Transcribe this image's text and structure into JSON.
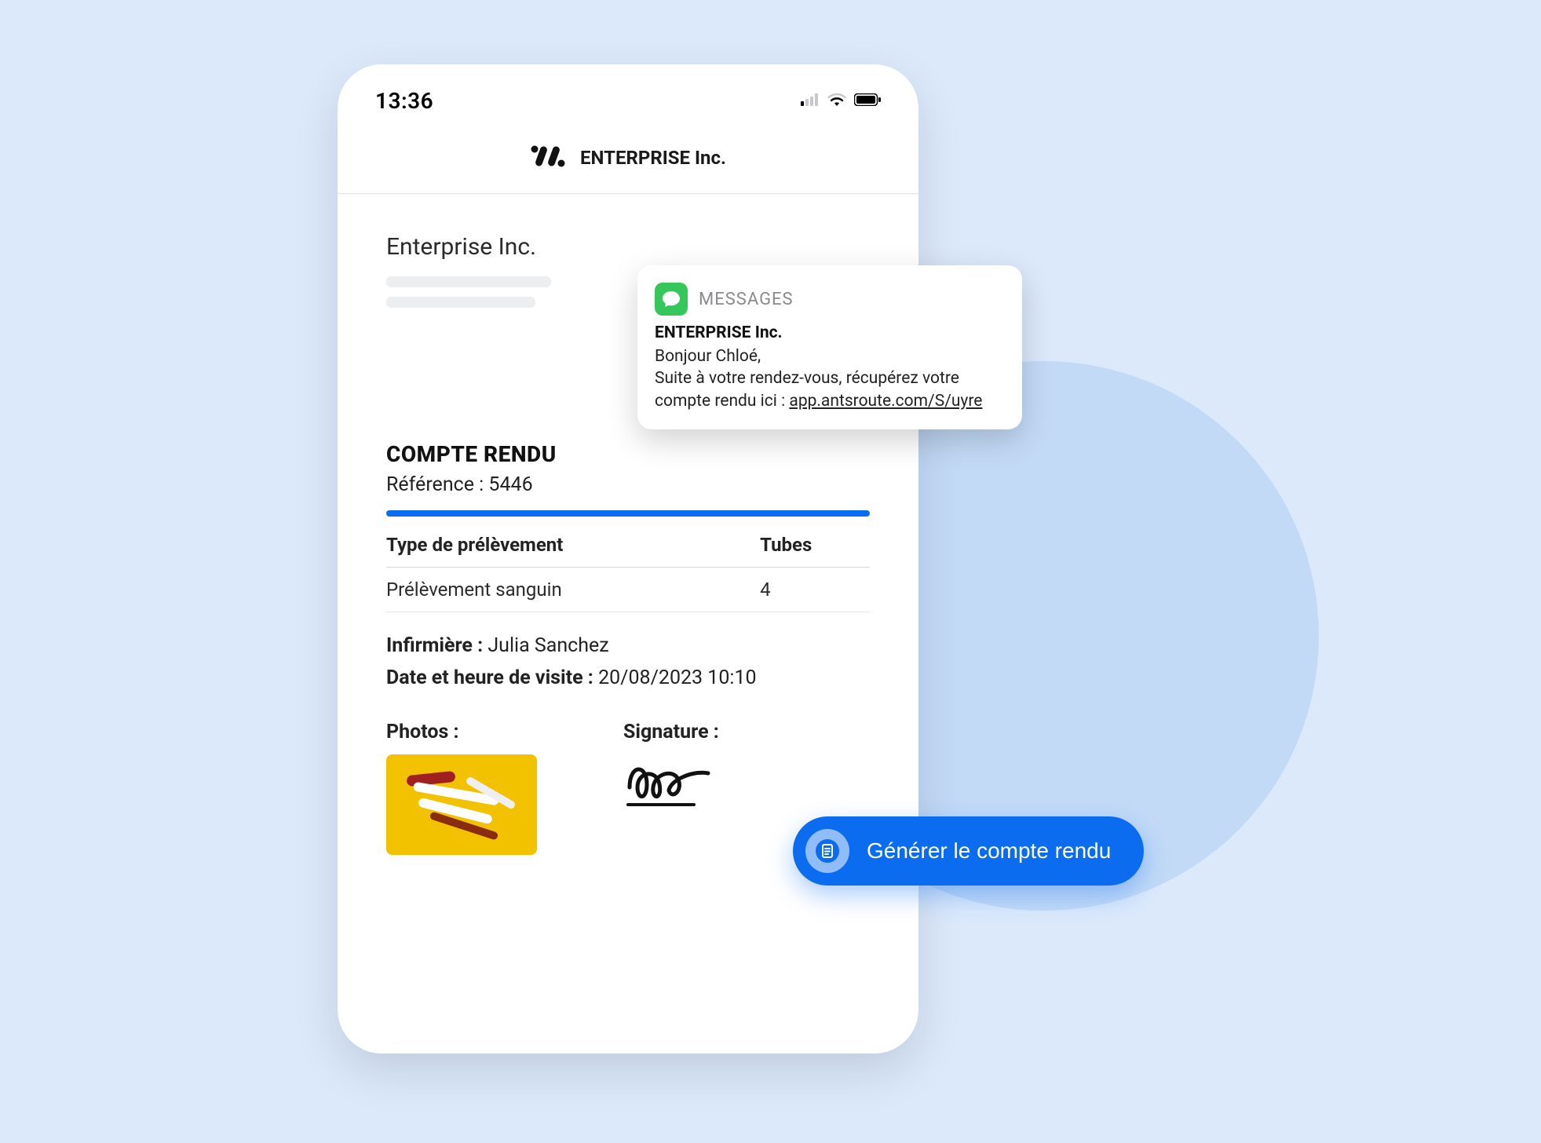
{
  "status": {
    "time": "13:36"
  },
  "header": {
    "brand": "ENTERPRISE Inc."
  },
  "company": {
    "title": "Enterprise Inc."
  },
  "report": {
    "section_title": "COMPTE RENDU",
    "reference_label": "Référence :",
    "reference_value": "5446",
    "table": {
      "headers": {
        "type": "Type de prélèvement",
        "tubes": "Tubes"
      },
      "rows": [
        {
          "type": "Prélèvement sanguin",
          "tubes": "4"
        }
      ]
    },
    "nurse_label": "Infirmière :",
    "nurse_value": "Julia Sanchez",
    "visit_label": "Date et heure de visite :",
    "visit_value": "20/08/2023 10:10",
    "photos_label": "Photos :",
    "signature_label": "Signature :"
  },
  "notification": {
    "app": "MESSAGES",
    "sender": "ENTERPRISE Inc.",
    "greeting": "Bonjour Chloé,",
    "line2_pre": "Suite à votre rendez-vous, récupérez votre compte rendu ici : ",
    "link": "app.antsroute.com/S/uyre"
  },
  "cta": {
    "label": "Générer le compte rendu"
  }
}
